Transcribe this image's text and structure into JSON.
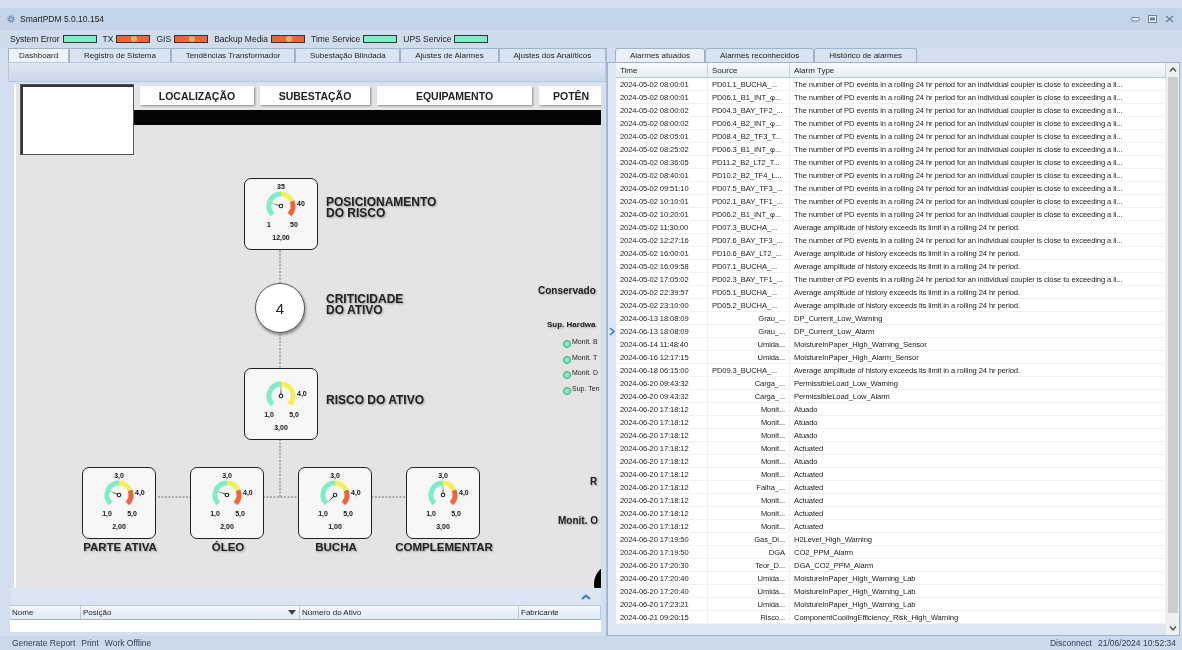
{
  "window": {
    "title": "SmartPDM 5.0.10.154"
  },
  "indicators": [
    {
      "label": "System Error",
      "fault": false
    },
    {
      "label": "TX",
      "fault": true
    },
    {
      "label": "GIS",
      "fault": true
    },
    {
      "label": "Backup Media",
      "fault": true
    },
    {
      "label": "Time Service",
      "fault": false
    },
    {
      "label": "UPS Service",
      "fault": false
    }
  ],
  "left_tabs": [
    {
      "label": "Dashboard",
      "selected": true
    },
    {
      "label": "Registro de Sistema",
      "selected": false
    },
    {
      "label": "Tendências Transformador",
      "selected": false
    },
    {
      "label": "Subestação Blindada",
      "selected": false
    },
    {
      "label": "Ajustes de Alarmes",
      "selected": false
    },
    {
      "label": "Ajustes dos Analíticos",
      "selected": false
    }
  ],
  "dashboard": {
    "header_buttons": [
      "LOCALIZAÇÃO",
      "SUBESTAÇÃO",
      "EQUIPAMENTO",
      "POTÊN"
    ],
    "risk_position": {
      "title": "POSICIONAMENTO\nDO RISCO",
      "gauge": {
        "kind": "three_zone",
        "top_mark": "35",
        "right_mark": "40",
        "min": "1",
        "max": "50",
        "value": "12,00"
      }
    },
    "criticality": {
      "value": "4",
      "title": "CRITICIDADE\nDO ATIVO"
    },
    "asset_risk": {
      "title": "RISCO DO ATIVO",
      "gauge": {
        "kind": "two_zone",
        "right_mark": "4,0",
        "min": "1,0",
        "max": "5,0",
        "value": "3,00"
      }
    },
    "components": [
      {
        "label": "PARTE ATIVA",
        "gauge": {
          "kind": "three_zone",
          "top_mark": "3,0",
          "right_mark": "4,0",
          "min": "1,0",
          "max": "5,0",
          "value": "2,00"
        }
      },
      {
        "label": "ÓLEO",
        "gauge": {
          "kind": "three_zone",
          "top_mark": "3,0",
          "right_mark": "4,0",
          "min": "1,0",
          "max": "5,0",
          "value": "2,00"
        }
      },
      {
        "label": "BUCHA",
        "gauge": {
          "kind": "three_zone",
          "top_mark": "3,0",
          "right_mark": "4,0",
          "min": "1,0",
          "max": "5,0",
          "value": "1,00"
        }
      },
      {
        "label": "COMPLEMENTAR",
        "gauge": {
          "kind": "three_zone",
          "top_mark": "3,0",
          "right_mark": "4,0",
          "min": "1,0",
          "max": "5,0",
          "value": "3,00"
        }
      }
    ],
    "side": {
      "title": "Conservado",
      "subtitle": "Sup. Hardwa",
      "items": [
        "Monit. B",
        "Monit. T",
        "Monit. D",
        "Sup. Ten"
      ],
      "label_r": "R",
      "label_monit": "Monit. O"
    }
  },
  "asset_table": {
    "columns": [
      "Nome",
      "Posição",
      "Número do Ativo",
      "Fabricante"
    ]
  },
  "right_tabs": [
    {
      "label": "Alarmes atuados",
      "selected": true
    },
    {
      "label": "Alarmes reconhecidos",
      "selected": false
    },
    {
      "label": "Histórico de alarmes",
      "selected": false
    }
  ],
  "alarms": {
    "columns": [
      "Time",
      "Source",
      "Alarm Type"
    ],
    "rows": [
      {
        "time": "2024-05-02 08:00:01",
        "source": "PD01.1_BUCHA_...",
        "alarm_type": "The number of PD events in a rolling 24 hr period for an individual coupler is close to exceeding a li...",
        "kind": "pd",
        "selected": false
      },
      {
        "time": "2024-05-02 08:00:01",
        "source": "PD06.1_B1_INT_φ...",
        "alarm_type": "The number of PD events in a rolling 24 hr period for an individual coupler is close to exceeding a li...",
        "kind": "pd",
        "selected": false
      },
      {
        "time": "2024-05-02 08:00:02",
        "source": "PD04.3_BAY_TF2_...",
        "alarm_type": "The number of PD events in a rolling 24 hr period for an individual coupler is close to exceeding a li...",
        "kind": "pd",
        "selected": false
      },
      {
        "time": "2024-05-02 08:00:02",
        "source": "PD06.4_B2_INT_φ...",
        "alarm_type": "The number of PD events in a rolling 24 hr period for an individual coupler is close to exceeding a li...",
        "kind": "pd",
        "selected": false
      },
      {
        "time": "2024-05-02 08:05:01",
        "source": "PD08.4_B2_TF3_T...",
        "alarm_type": "The number of PD events in a rolling 24 hr period for an individual coupler is close to exceeding a li...",
        "kind": "pd",
        "selected": false
      },
      {
        "time": "2024-05-02 08:25:02",
        "source": "PD06.3_B1_INT_φ...",
        "alarm_type": "The number of PD events in a rolling 24 hr period for an individual coupler is close to exceeding a li...",
        "kind": "pd",
        "selected": false
      },
      {
        "time": "2024-05-02 08:36:05",
        "source": "PD11.2_B2_LT2_T...",
        "alarm_type": "The number of PD events in a rolling 24 hr period for an individual coupler is close to exceeding a li...",
        "kind": "pd",
        "selected": false
      },
      {
        "time": "2024-05-02 08:40:01",
        "source": "PD10.2_B2_TF4_L...",
        "alarm_type": "The number of PD events in a rolling 24 hr period for an individual coupler is close to exceeding a li...",
        "kind": "pd",
        "selected": false
      },
      {
        "time": "2024-05-02 09:51:10",
        "source": "PD07.5_BAY_TF3_...",
        "alarm_type": "The number of PD events in a rolling 24 hr period for an individual coupler is close to exceeding a li...",
        "kind": "pd",
        "selected": false
      },
      {
        "time": "2024-05-02 10:10:01",
        "source": "PD02.1_BAY_TF1_...",
        "alarm_type": "The number of PD events in a rolling 24 hr period for an individual coupler is close to exceeding a li...",
        "kind": "pd",
        "selected": false
      },
      {
        "time": "2024-05-02 10:20:01",
        "source": "PD06.2_B1_INT_φ...",
        "alarm_type": "The number of PD events in a rolling 24 hr period for an individual coupler is close to exceeding a li...",
        "kind": "pd",
        "selected": false
      },
      {
        "time": "2024-05-02 11:30:00",
        "source": "PD07.3_BUCHA_...",
        "alarm_type": "Average amplitude of history exceeds its limit in a rolling 24 hr period.",
        "kind": "pd",
        "selected": false
      },
      {
        "time": "2024-05-02 12:27:16",
        "source": "PD07.6_BAY_TF3_...",
        "alarm_type": "The number of PD events in a rolling 24 hr period for an individual coupler is close to exceeding a li...",
        "kind": "pd",
        "selected": false
      },
      {
        "time": "2024-05-02 16:00:01",
        "source": "PD10.6_BAY_LT2_...",
        "alarm_type": "Average amplitude of history exceeds its limit in a rolling 24 hr period.",
        "kind": "pd",
        "selected": false
      },
      {
        "time": "2024-05-02 16:09:58",
        "source": "PD07.1_BUCHA_...",
        "alarm_type": "Average amplitude of history exceeds its limit in a rolling 24 hr period.",
        "kind": "pd",
        "selected": false
      },
      {
        "time": "2024-05-02 17:05:02",
        "source": "PD02.3_BAY_TF1_...",
        "alarm_type": "The number of PD events in a rolling 24 hr period for an individual coupler is close to exceeding a li...",
        "kind": "pd",
        "selected": false
      },
      {
        "time": "2024-05-02 22:39:57",
        "source": "PD05.1_BUCHA_...",
        "alarm_type": "Average amplitude of history exceeds its limit in a rolling 24 hr period.",
        "kind": "pd",
        "selected": false
      },
      {
        "time": "2024-05-02 23:10:00",
        "source": "PD05.2_BUCHA_...",
        "alarm_type": "Average amplitude of history exceeds its limit in a rolling 24 hr period.",
        "kind": "pd",
        "selected": false
      },
      {
        "time": "2024-06-13 18:08:09",
        "source": "Grau_...",
        "alarm_type": "DP_Current_Low_Warning",
        "kind": "sensor",
        "selected": false
      },
      {
        "time": "2024-06-13 18:08:09",
        "source": "Grau_...",
        "alarm_type": "DP_Current_Low_Alarm",
        "kind": "sensor",
        "selected": true
      },
      {
        "time": "2024-06-14 11:48:40",
        "source": "Umida...",
        "alarm_type": "MoistureInPaper_High_Warning_Sensor",
        "kind": "sensor",
        "selected": false
      },
      {
        "time": "2024-06-16 12:17:15",
        "source": "Umida...",
        "alarm_type": "MoistureInPaper_High_Alarm_Sensor",
        "kind": "sensor",
        "selected": false
      },
      {
        "time": "2024-06-18 06:15:00",
        "source": "PD09.3_BUCHA_...",
        "alarm_type": "Average amplitude of history exceeds its limit in a rolling 24 hr period.",
        "kind": "pd",
        "selected": false
      },
      {
        "time": "2024-06-20 09:43:32",
        "source": "Carga_...",
        "alarm_type": "PermissibleLoad_Low_Warning",
        "kind": "sensor",
        "selected": false
      },
      {
        "time": "2024-06-20 09:43:32",
        "source": "Carga_...",
        "alarm_type": "PermissibleLoad_Low_Alarm",
        "kind": "sensor",
        "selected": false
      },
      {
        "time": "2024-06-20 17:18:12",
        "source": "Monit...",
        "alarm_type": "Atuado",
        "kind": "sensor",
        "selected": false
      },
      {
        "time": "2024-06-20 17:18:12",
        "source": "Monit...",
        "alarm_type": "Atuado",
        "kind": "sensor",
        "selected": false
      },
      {
        "time": "2024-06-20 17:18:12",
        "source": "Monit...",
        "alarm_type": "Atuado",
        "kind": "sensor",
        "selected": false
      },
      {
        "time": "2024-06-20 17:18:12",
        "source": "Monit...",
        "alarm_type": "Actuated",
        "kind": "sensor",
        "selected": false
      },
      {
        "time": "2024-06-20 17:18:12",
        "source": "Monit...",
        "alarm_type": "Atuado",
        "kind": "sensor",
        "selected": false
      },
      {
        "time": "2024-06-20 17:18:12",
        "source": "Monit...",
        "alarm_type": "Actuated",
        "kind": "sensor",
        "selected": false
      },
      {
        "time": "2024-06-20 17:18:12",
        "source": "Falha_...",
        "alarm_type": "Actuated",
        "kind": "sensor",
        "selected": false
      },
      {
        "time": "2024-06-20 17:18:12",
        "source": "Monit...",
        "alarm_type": "Actuated",
        "kind": "sensor",
        "selected": false
      },
      {
        "time": "2024-06-20 17:18:12",
        "source": "Monit...",
        "alarm_type": "Actuated",
        "kind": "sensor",
        "selected": false
      },
      {
        "time": "2024-06-20 17:18:12",
        "source": "Monit...",
        "alarm_type": "Actuated",
        "kind": "sensor",
        "selected": false
      },
      {
        "time": "2024-06-20 17:19:50",
        "source": "Gas_Di...",
        "alarm_type": "H2Level_High_Warning",
        "kind": "sensor",
        "selected": false
      },
      {
        "time": "2024-06-20 17:19:50",
        "source": "DGA",
        "alarm_type": "CO2_PPM_Alarm",
        "kind": "sensor",
        "selected": false
      },
      {
        "time": "2024-06-20 17:20:30",
        "source": "Teor_D...",
        "alarm_type": "DGA_CO2_PPM_Alarm",
        "kind": "sensor",
        "selected": false
      },
      {
        "time": "2024-06-20 17:20:40",
        "source": "Umida...",
        "alarm_type": "MoistureInPaper_High_Warning_Lab",
        "kind": "sensor",
        "selected": false
      },
      {
        "time": "2024-06-20 17:20:40",
        "source": "Umida...",
        "alarm_type": "MoistureInPaper_High_Warning_Lab",
        "kind": "sensor",
        "selected": false
      },
      {
        "time": "2024-06-20 17:23:21",
        "source": "Umida...",
        "alarm_type": "MoistureInPaper_High_Warning_Lab",
        "kind": "sensor",
        "selected": false
      },
      {
        "time": "2024-06-21 09:20:15",
        "source": "Risco...",
        "alarm_type": "ComponentCoolingEfficiency_Risk_High_Warning",
        "kind": "sensor",
        "selected": false
      }
    ]
  },
  "footer": {
    "actions": [
      "Generate Report",
      "Print",
      "Work Offline"
    ],
    "connection": "Disconnect",
    "timestamp": "21/06/2024 10:52:34"
  }
}
